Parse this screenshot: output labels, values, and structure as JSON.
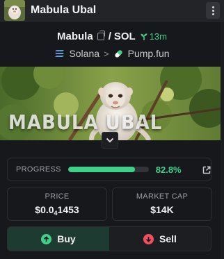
{
  "header": {
    "title": "Mabula Ubal"
  },
  "pair": {
    "base": "Mabula",
    "slash": "/",
    "quote": "SOL",
    "age": "13m"
  },
  "chain": {
    "network": "Solana",
    "separator": ">",
    "dex": "Pump.fun"
  },
  "banner": {
    "text": "MABULA UBAL"
  },
  "progress": {
    "label": "PROGRESS",
    "value_text": "82.8%",
    "fraction": 0.828
  },
  "stats": {
    "price_label": "PRICE",
    "price_prefix": "$0.0",
    "price_zeros": "4",
    "price_digits": "1453",
    "mcap_label": "MARKET CAP",
    "mcap_value": "$14K"
  },
  "trade": {
    "buy_label": "Buy",
    "sell_label": "Sell"
  },
  "colors": {
    "accent_green": "#3fd08a",
    "sell_red": "#ef4f5f",
    "background": "#17181c"
  }
}
